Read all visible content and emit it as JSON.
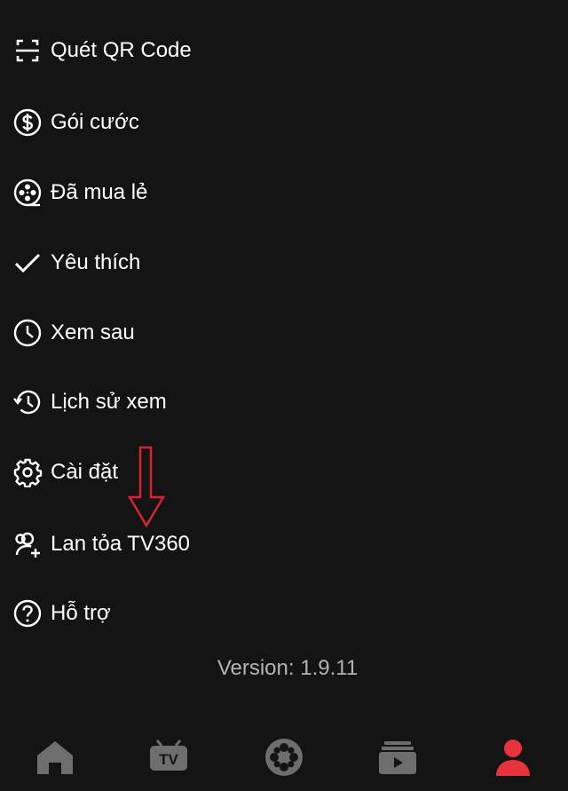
{
  "menu": {
    "items": [
      {
        "label": "Quét QR Code",
        "icon": "qr-scan-icon"
      },
      {
        "label": "Gói cước",
        "icon": "dollar-circle-icon"
      },
      {
        "label": "Đã mua lẻ",
        "icon": "film-reel-icon"
      },
      {
        "label": "Yêu thích",
        "icon": "checkmark-icon"
      },
      {
        "label": "Xem sau",
        "icon": "clock-icon"
      },
      {
        "label": "Lịch sử xem",
        "icon": "history-icon"
      },
      {
        "label": "Cài đặt",
        "icon": "gear-icon"
      },
      {
        "label": "Lan tỏa TV360",
        "icon": "share-user-icon"
      },
      {
        "label": "Hỗ trợ",
        "icon": "help-circle-icon"
      }
    ]
  },
  "version": {
    "text": "Version: 1.9.11"
  },
  "annotation": {
    "arrow_color": "#d9232d"
  },
  "bottom_nav": {
    "items": [
      {
        "icon": "home-icon",
        "active": false
      },
      {
        "icon": "tv-icon",
        "label": "TV",
        "active": false
      },
      {
        "icon": "film-reel-icon",
        "active": false
      },
      {
        "icon": "library-icon",
        "active": false
      },
      {
        "icon": "profile-icon",
        "active": true
      }
    ],
    "inactive_color": "#6e6e6e",
    "active_color": "#e8323c"
  }
}
